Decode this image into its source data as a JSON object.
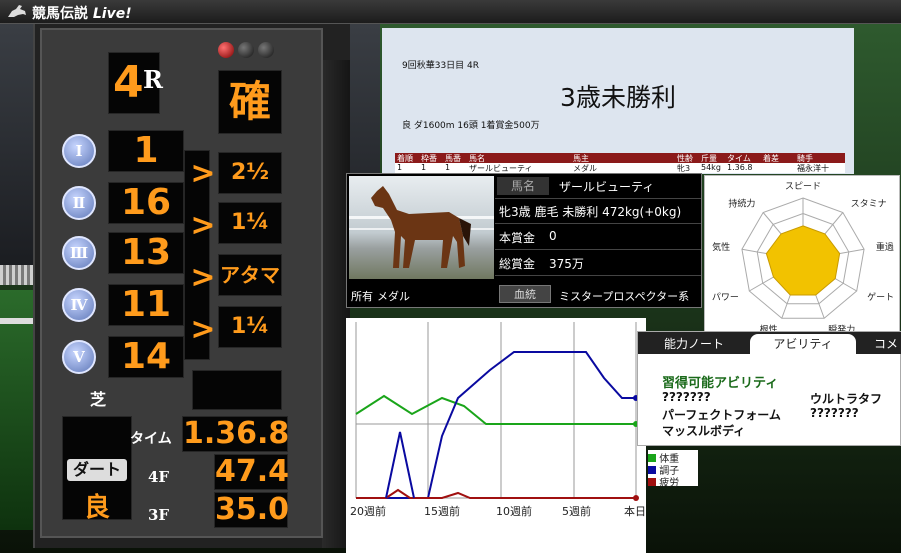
{
  "window": {
    "title": "競馬伝説",
    "title_suffix": "Live!"
  },
  "scoreboard": {
    "race_number": "4",
    "race_suffix": "R",
    "status": "確",
    "places": [
      {
        "roman": "I",
        "horse": "1",
        "margin": "2½"
      },
      {
        "roman": "II",
        "horse": "16",
        "margin": "1¼"
      },
      {
        "roman": "III",
        "horse": "13",
        "margin": "アタマ"
      },
      {
        "roman": "IV",
        "horse": "11",
        "margin": "1¼"
      },
      {
        "roman": "V",
        "horse": "14",
        "margin": ""
      }
    ],
    "separator": ">",
    "surface_turf": "芝",
    "surface_dirt": "ダート",
    "condition": "良",
    "time_label": "タイム",
    "time": "1.36.8",
    "f4_label": "4F",
    "f4": "47.4",
    "f3_label": "3F",
    "f3": "35.0"
  },
  "race_doc": {
    "meta": "9回秋華33日目 4R",
    "title": "3歳未勝利",
    "details": "良 ダ1600m 16頭 1着賞金500万",
    "columns": [
      "着順",
      "枠番",
      "馬番",
      "馬名",
      "馬主",
      "性齢",
      "斤量",
      "タイム",
      "着差",
      "騎手"
    ],
    "row": [
      "1",
      "1",
      "1",
      "ザールビューティ",
      "メダル",
      "牝3",
      "54kg",
      "1.36.8",
      "",
      "福永洋十"
    ]
  },
  "horse": {
    "name_label": "馬名",
    "name": "ザールビューティ",
    "profile": "牝3歳 鹿毛 未勝利 472kg(+0kg)",
    "prize_label": "本賞金",
    "prize": "0",
    "total_label": "総賞金",
    "total": "375万",
    "owner_label": "所有",
    "owner": "メダル",
    "bloodline_button": "血統",
    "sire": "ミスタープロスペクター系"
  },
  "radar": {
    "labels": [
      "スピード",
      "スタミナ",
      "重過",
      "ゲート",
      "瞬発力",
      "根性",
      "パワー",
      "気性",
      "持続力"
    ],
    "values": [
      0.55,
      0.55,
      0.6,
      0.6,
      0.6,
      0.6,
      0.55,
      0.6,
      0.55
    ],
    "fill": "#f2c200"
  },
  "condition_chart": {
    "x_labels": [
      "20週前",
      "15週前",
      "10週前",
      "5週前",
      "本日"
    ],
    "legend": [
      {
        "name": "体重",
        "color": "#1aa51a"
      },
      {
        "name": "調子",
        "color": "#0a0aa0"
      },
      {
        "name": "疲労",
        "color": "#a01010"
      }
    ]
  },
  "abilities": {
    "tabs": [
      "能力ノート",
      "アビリティ",
      "コメ"
    ],
    "heading": "習得可能アビリティ",
    "items": [
      "???????",
      "ウルトラタフ",
      "パーフェクトフォーム",
      "???????",
      "マッスルボディ"
    ]
  }
}
